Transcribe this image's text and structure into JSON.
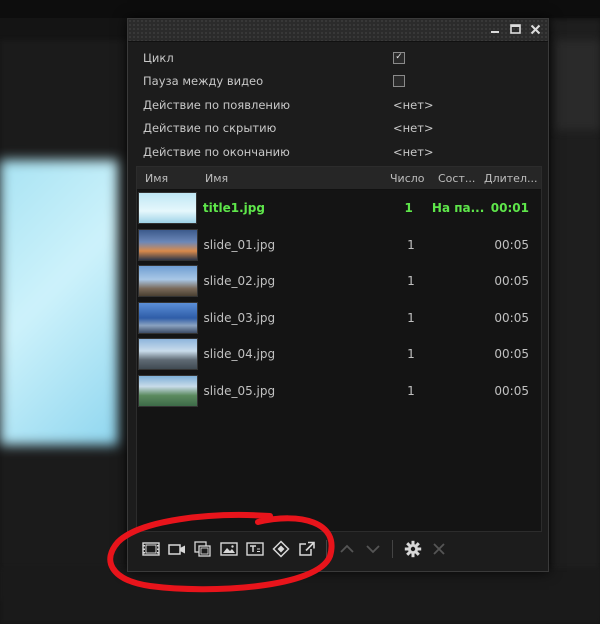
{
  "properties": [
    {
      "label": "Цикл",
      "type": "checkbox",
      "checked": true
    },
    {
      "label": "Пауза между видео",
      "type": "checkbox",
      "checked": false
    },
    {
      "label": "Действие по появлению",
      "type": "text",
      "value": "<нет>"
    },
    {
      "label": "Действие по скрытию",
      "type": "text",
      "value": "<нет>"
    },
    {
      "label": "Действие по окончанию",
      "type": "text",
      "value": "<нет>"
    }
  ],
  "columns": {
    "thumb": "Имя",
    "name": "Имя",
    "count": "Число",
    "state": "Сост...",
    "duration": "Длител..."
  },
  "rows": [
    {
      "name": "title1.jpg",
      "count": "1",
      "state": "На па...",
      "duration": "00:01",
      "active": true
    },
    {
      "name": "slide_01.jpg",
      "count": "1",
      "state": "",
      "duration": "00:05",
      "active": false
    },
    {
      "name": "slide_02.jpg",
      "count": "1",
      "state": "",
      "duration": "00:05",
      "active": false
    },
    {
      "name": "slide_03.jpg",
      "count": "1",
      "state": "",
      "duration": "00:05",
      "active": false
    },
    {
      "name": "slide_04.jpg",
      "count": "1",
      "state": "",
      "duration": "00:05",
      "active": false
    },
    {
      "name": "slide_05.jpg",
      "count": "1",
      "state": "",
      "duration": "00:05",
      "active": false
    }
  ],
  "toolbar_icons": [
    "film-strip-icon",
    "video-camera-icon",
    "copy-clips-icon",
    "image-icon",
    "text-title-icon",
    "diamond-icon",
    "external-link-icon",
    "arrow-up-icon",
    "arrow-down-icon",
    "gear-icon",
    "close-icon"
  ],
  "colors": {
    "active_row": "#5ee64a",
    "annotation": "#e8141b",
    "panel_bg": "#1c1c1c"
  }
}
